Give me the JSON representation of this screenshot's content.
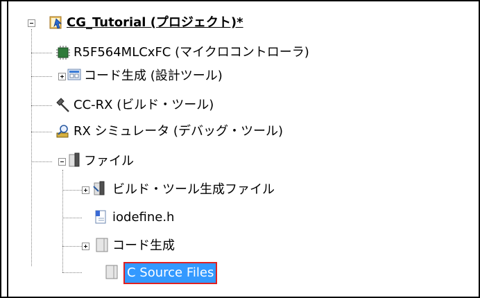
{
  "tree": {
    "root": {
      "label": "CG_Tutorial (プロジェクト)*",
      "icon": "project-icon",
      "expanded": true
    },
    "items": [
      {
        "label": "R5F564MLCxFC (マイクロコントローラ)",
        "icon": "microcontroller-chip-icon"
      },
      {
        "label": "コード生成 (設計ツール)",
        "icon": "code-generator-icon",
        "expandable": true,
        "expanded": false
      },
      {
        "label": "CC-RX (ビルド・ツール)",
        "icon": "hammer-icon"
      },
      {
        "label": "RX シミュレータ (デバッグ・ツール)",
        "icon": "debugger-icon"
      },
      {
        "label": "ファイル",
        "icon": "folder-icon",
        "expandable": true,
        "expanded": true,
        "children": [
          {
            "label": "ビルド・ツール生成ファイル",
            "icon": "folder-icon",
            "expandable": true,
            "expanded": false
          },
          {
            "label": "iodefine.h",
            "icon": "header-file-icon"
          },
          {
            "label": "コード生成",
            "icon": "folder-icon",
            "expandable": true,
            "expanded": false
          },
          {
            "label": "C Source Files",
            "icon": "folder-icon",
            "selected": true
          }
        ]
      }
    ]
  },
  "colors": {
    "selection": "#3399ff",
    "highlight_border": "#e02020"
  }
}
